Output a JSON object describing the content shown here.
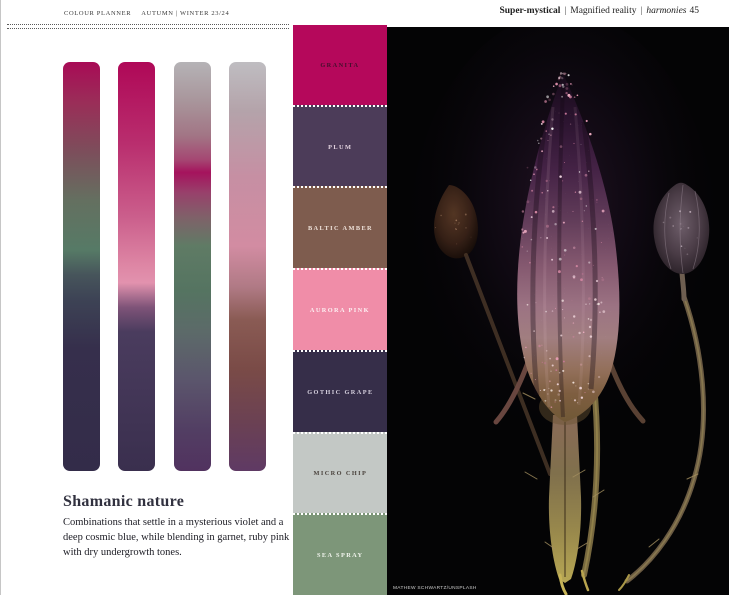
{
  "header_left": {
    "brand": "COLOUR PLANNER",
    "season": "AUTUMN | WINTER 23/24"
  },
  "header_right": {
    "theme": "Super-mystical",
    "separator": "|",
    "subtitle": "Magnified reality",
    "section": "harmonies",
    "page_number": "45"
  },
  "story": {
    "title": "Shamanic nature",
    "description": "Combinations that settle in a mysterious violet and a deep cosmic blue, while blending in garnet, ruby pink with dry undergrowth tones."
  },
  "gradient_bars": [
    {
      "name": "bar-1",
      "stops": [
        {
          "pos": 0,
          "color": "#A80B56"
        },
        {
          "pos": 10,
          "color": "#9A2E58"
        },
        {
          "pos": 22,
          "color": "#7C4E5B"
        },
        {
          "pos": 34,
          "color": "#647060"
        },
        {
          "pos": 46,
          "color": "#567A66"
        },
        {
          "pos": 52,
          "color": "#47555B"
        },
        {
          "pos": 58,
          "color": "#3D4355"
        },
        {
          "pos": 70,
          "color": "#362F4C"
        },
        {
          "pos": 100,
          "color": "#332C49"
        }
      ]
    },
    {
      "name": "bar-2",
      "stops": [
        {
          "pos": 0,
          "color": "#AF0857"
        },
        {
          "pos": 20,
          "color": "#B92E6E"
        },
        {
          "pos": 38,
          "color": "#CB5F8C"
        },
        {
          "pos": 50,
          "color": "#DE87A5"
        },
        {
          "pos": 54,
          "color": "#E292AE"
        },
        {
          "pos": 60,
          "color": "#7E5378"
        },
        {
          "pos": 66,
          "color": "#4A3C5E"
        },
        {
          "pos": 100,
          "color": "#3A2F4E"
        }
      ]
    },
    {
      "name": "bar-3",
      "stops": [
        {
          "pos": 0,
          "color": "#B5B3B6"
        },
        {
          "pos": 10,
          "color": "#A8949A"
        },
        {
          "pos": 18,
          "color": "#A27585"
        },
        {
          "pos": 24,
          "color": "#A54672"
        },
        {
          "pos": 27,
          "color": "#A5135D"
        },
        {
          "pos": 32,
          "color": "#98416B"
        },
        {
          "pos": 38,
          "color": "#7F6169"
        },
        {
          "pos": 45,
          "color": "#5F7B65"
        },
        {
          "pos": 56,
          "color": "#557461"
        },
        {
          "pos": 66,
          "color": "#5C6A69"
        },
        {
          "pos": 78,
          "color": "#5B556C"
        },
        {
          "pos": 90,
          "color": "#523E63"
        },
        {
          "pos": 100,
          "color": "#51325F"
        }
      ]
    },
    {
      "name": "bar-4",
      "stops": [
        {
          "pos": 0,
          "color": "#BFBDC1"
        },
        {
          "pos": 12,
          "color": "#B4A3AA"
        },
        {
          "pos": 28,
          "color": "#C68FA3"
        },
        {
          "pos": 45,
          "color": "#D28CA2"
        },
        {
          "pos": 55,
          "color": "#B07A85"
        },
        {
          "pos": 63,
          "color": "#8A5B54"
        },
        {
          "pos": 75,
          "color": "#7A4B47"
        },
        {
          "pos": 88,
          "color": "#6B4153"
        },
        {
          "pos": 100,
          "color": "#5F3A64"
        }
      ]
    }
  ],
  "swatches": [
    {
      "name": "GRANITA",
      "color": "#B5085B",
      "text_color": "#43102C"
    },
    {
      "name": "PLUM",
      "color": "#4C3C59",
      "text_color": "#E3D3DF"
    },
    {
      "name": "BALTIC AMBER",
      "color": "#7E5C4E",
      "text_color": "#EFE2DA"
    },
    {
      "name": "AURORA PINK",
      "color": "#F08DA8",
      "text_color": "#FDF0F3"
    },
    {
      "name": "GOTHIC GRAPE",
      "color": "#362E49",
      "text_color": "#D6D0DE"
    },
    {
      "name": "MICRO CHIP",
      "color": "#C3C8C5",
      "text_color": "#4B443E"
    },
    {
      "name": "SEA SPRAY",
      "color": "#7D9679",
      "text_color": "#F2F5EE"
    }
  ],
  "photo": {
    "credit": "MATHEW SCHWARTZ/UNSPLASH"
  }
}
